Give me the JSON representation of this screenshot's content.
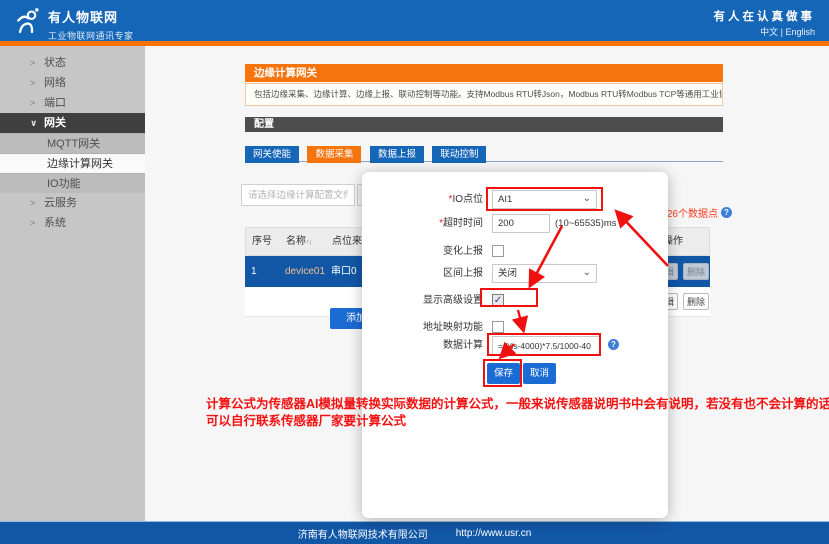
{
  "icons": {
    "chevron_down": "⌄",
    "collapse_arrow": ">",
    "expand_arrow": "∨",
    "sort": "↑↓",
    "help": "?",
    "check": "✓"
  },
  "colors": {
    "brand_blue": "#1566b7",
    "accent_orange": "#f7730c",
    "selected_row_blue": "#1257a6",
    "annotation_red": "#f31212"
  },
  "header": {
    "brand": "有人物联网",
    "brand_subtitle": "工业物联网通讯专家",
    "slogan": "有人在认真做事",
    "language_switch": "中文 | English"
  },
  "sidebar": {
    "items": [
      {
        "label": "状态"
      },
      {
        "label": "网络"
      },
      {
        "label": "端口"
      },
      {
        "label": "网关"
      },
      {
        "label": "MQTT网关"
      },
      {
        "label": "边缘计算网关"
      },
      {
        "label": "IO功能"
      },
      {
        "label": "云服务"
      },
      {
        "label": "系统"
      }
    ]
  },
  "page": {
    "title": "边缘计算网关",
    "description": "包括边缘采集、边缘计算、边缘上报、联动控制等功能。支持Modbus RTU转Json，Modbus RTU转Modbus TCP等通用工业协议转换。",
    "section_title": "配置",
    "tabs": [
      {
        "label": "网关使能"
      },
      {
        "label": "数据采集"
      },
      {
        "label": "数据上报"
      },
      {
        "label": "联动控制"
      }
    ],
    "file_placeholder": "请选择边缘计算配置文件",
    "datapoint_count": "126个数据点",
    "add_button": "添加",
    "table": {
      "headers": {
        "no": "序号",
        "name": "名称",
        "source": "点位来源",
        "action": "操作"
      },
      "rows": [
        {
          "no": "1",
          "name": "device01",
          "source": "串口0",
          "edit": "编辑",
          "del": "删除"
        },
        {
          "no": "",
          "name": "",
          "source": "",
          "edit": "编辑",
          "del": "删除"
        }
      ]
    }
  },
  "modal": {
    "io_required": "*",
    "io_label": "IO点位",
    "io_value": "AI1",
    "timeout_required": "*",
    "timeout_label": "超时时间",
    "timeout_value": "200",
    "timeout_suffix": "(10~65535)ms",
    "change_label": "变化上报",
    "range_label": "区间上报",
    "range_value": "关闭",
    "advanced_label": "显示高级设置",
    "addrmap_label": "地址映射功能",
    "calc_label": "数据计算",
    "calc_value": "=(%s-4000)*7.5/1000-40",
    "save": "保存",
    "cancel": "取消"
  },
  "annotation": {
    "line1": "计算公式为传感器AI模拟量转换实际数据的计算公式，一般来说传感器说明书中会有说明，若没有也不会计算的话，",
    "line2": "可以自行联系传感器厂家要计算公式"
  },
  "footer": {
    "company": "济南有人物联网技术有限公司",
    "url": "http://www.usr.cn"
  }
}
